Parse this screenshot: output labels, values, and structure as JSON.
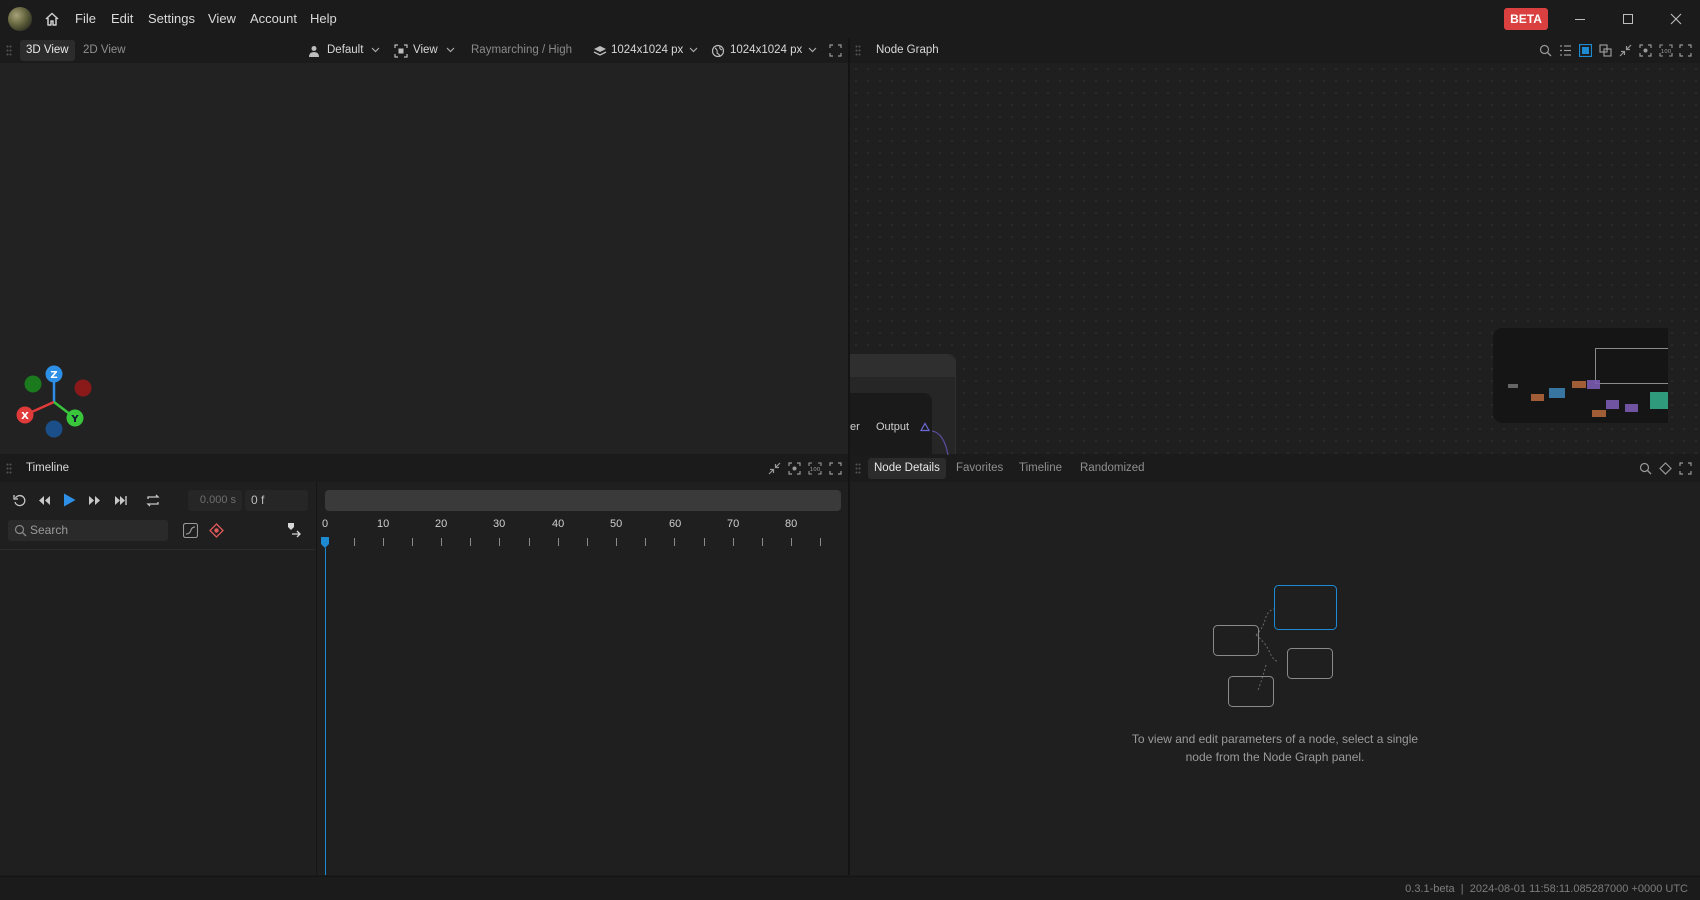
{
  "menu": {
    "file": "File",
    "edit": "Edit",
    "settings": "Settings",
    "view": "View",
    "account": "Account",
    "help": "Help"
  },
  "beta_badge": "BETA",
  "viewport": {
    "tab_3d": "3D View",
    "tab_2d": "2D View",
    "camera_preset": "Default",
    "view_menu": "View",
    "render_mode": "Raymarching / High",
    "resolution_a": "1024x1024 px",
    "resolution_b": "1024x1024 px",
    "axis_labels": {
      "z": "Z",
      "x": "X",
      "y": "Y"
    }
  },
  "node_graph": {
    "title": "Node Graph",
    "node_fragment_label": "er",
    "node_output_label": "Output"
  },
  "timeline": {
    "title": "Timeline",
    "time_value": "0.000 s",
    "frame_value": "0 f",
    "search_placeholder": "Search",
    "ticks": [
      "0",
      "10",
      "20",
      "30",
      "40",
      "50",
      "60",
      "70",
      "80"
    ]
  },
  "details": {
    "tabs": [
      "Node Details",
      "Favorites",
      "Timeline",
      "Randomized"
    ],
    "empty_line1": "To view and edit parameters of a node, select a single",
    "empty_line2": "node from the Node Graph panel."
  },
  "status": {
    "text": "0.3.1-beta  |  2024-08-01 11:58:11.085287000 +0000 UTC"
  },
  "colors": {
    "accent": "#1e8ad2",
    "beta": "#d9403f",
    "axis_x": "#e03a3a",
    "axis_y": "#39c63b",
    "axis_z": "#2d8fe6"
  }
}
